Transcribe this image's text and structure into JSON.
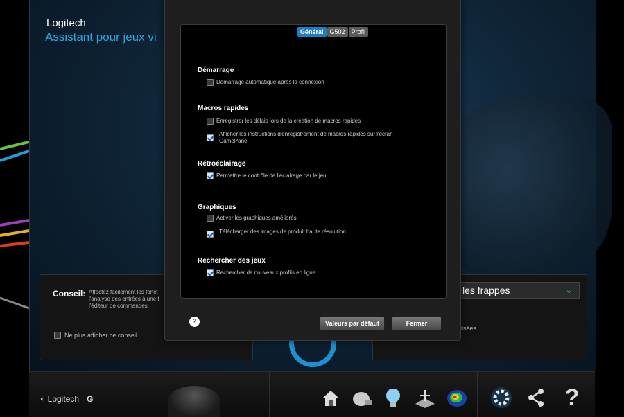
{
  "app": {
    "brand": "Logitech",
    "subtitle": "Assistant pour jeux vi"
  },
  "tip": {
    "label": "Conseil:",
    "text": "Affectez facilement les fonct l'analyse des entrées à une t l'éditeur de commandes.",
    "checkbox_label": "Ne plus afficher ce conseil",
    "checkbox_checked": false
  },
  "right_panel": {
    "select_value": "les frappes",
    "text": "ilisées"
  },
  "dialog": {
    "tabs": [
      {
        "label": "Général",
        "active": true
      },
      {
        "label": "G502",
        "active": false
      },
      {
        "label": "Profil",
        "active": false
      }
    ],
    "sections": {
      "startup": {
        "title": "Démarrage",
        "options": [
          {
            "label": "Démarrage automatique après la connexion",
            "checked": false
          }
        ]
      },
      "macros": {
        "title": "Macros rapides",
        "options": [
          {
            "label": "Enregistrer les délais lors de la création de macros rapides",
            "checked": false
          },
          {
            "label": "Afficher les instructions d'enregistrement de macros rapides sur l'écran GamePanel",
            "checked": true
          }
        ]
      },
      "backlight": {
        "title": "Rétroéclairage",
        "options": [
          {
            "label": "Permettre le contrôle de l'éclairage par le jeu",
            "checked": true
          }
        ]
      },
      "graphics": {
        "title": "Graphiques",
        "options": [
          {
            "label": "Activer les graphiques améliorés",
            "checked": false
          },
          {
            "label": "Télécharger des images de produit haute résolution",
            "checked": true
          }
        ]
      },
      "games": {
        "title": "Rechercher des jeux",
        "options": [
          {
            "label": "Rechercher de nouveaux profils en ligne",
            "checked": true
          }
        ]
      }
    },
    "help_label": "?",
    "defaults_label": "Valeurs par défaut",
    "close_label": "Fermer"
  },
  "bottom_bar": {
    "logo_text": "Logitech",
    "logo_g": "G",
    "icons": [
      "home-icon",
      "customize-buttons-icon",
      "lighting-icon",
      "surface-tuning-icon",
      "heatmap-icon",
      "settings-gear-icon",
      "share-icon",
      "help-question-icon"
    ]
  },
  "colors": {
    "accent": "#2aa7e0",
    "active_tab": "#1d7fc2"
  }
}
